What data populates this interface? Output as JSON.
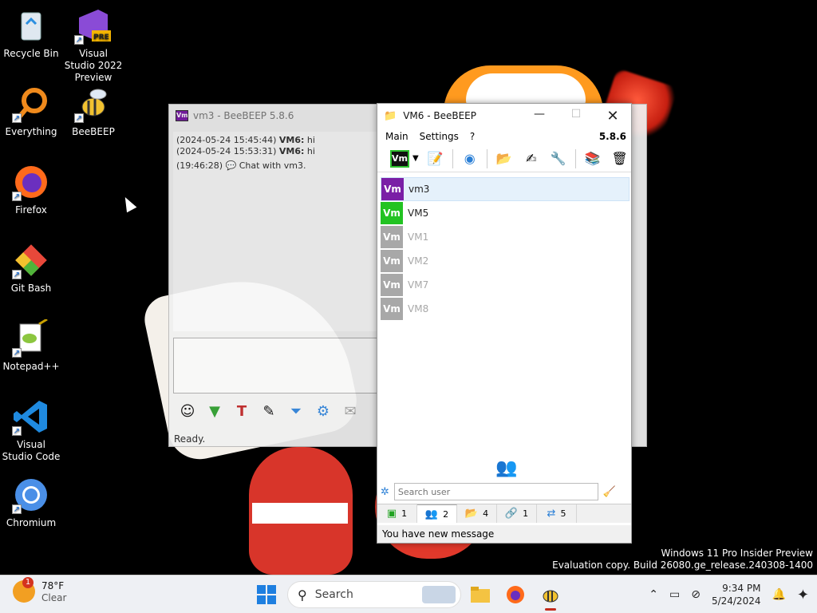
{
  "desktop": {
    "icons": [
      {
        "label": "Recycle Bin",
        "icon": "recycle-bin-icon"
      },
      {
        "label": "Visual Studio 2022 Preview",
        "icon": "visual-studio-preview-icon",
        "badge": "PRE"
      },
      {
        "label": "Everything",
        "icon": "everything-search-icon"
      },
      {
        "label": "BeeBEEP",
        "icon": "beebeep-icon"
      },
      {
        "label": "Firefox",
        "icon": "firefox-icon"
      },
      {
        "label": "Git Bash",
        "icon": "git-bash-icon"
      },
      {
        "label": "Notepad++",
        "icon": "notepad-plus-plus-icon"
      },
      {
        "label": "Visual Studio Code",
        "icon": "vscode-icon"
      },
      {
        "label": "Chromium",
        "icon": "chromium-icon"
      }
    ]
  },
  "chat_window": {
    "title": "vm3 - BeeBEEP 5.8.6",
    "badge": "Vm",
    "messages": [
      {
        "time": "(2024-05-24 15:45:44)",
        "sender": "VM6:",
        "text": " hi"
      },
      {
        "time": "(2024-05-24 15:53:31)",
        "sender": "VM6:",
        "text": " hi"
      },
      {
        "time": "(19:46:28)",
        "sender": "",
        "text": "Chat with vm3."
      }
    ],
    "status": "Ready."
  },
  "main_window": {
    "title": "VM6 - BeeBEEP",
    "version": "5.8.6",
    "menu": [
      "Main",
      "Settings",
      "?"
    ],
    "status_badge": "Vm",
    "users": [
      {
        "badge": "Vm",
        "name": "vm3",
        "state": "me",
        "selected": true
      },
      {
        "badge": "Vm",
        "name": "VM5",
        "state": "online"
      },
      {
        "badge": "Vm",
        "name": "VM1",
        "state": "off"
      },
      {
        "badge": "Vm",
        "name": "VM2",
        "state": "off"
      },
      {
        "badge": "Vm",
        "name": "VM7",
        "state": "off"
      },
      {
        "badge": "Vm",
        "name": "VM8",
        "state": "off"
      }
    ],
    "search_placeholder": "Search user",
    "tabs": [
      {
        "count": "1",
        "icon": "users-online-icon"
      },
      {
        "count": "2",
        "icon": "chats-icon"
      },
      {
        "count": "4",
        "icon": "groups-icon"
      },
      {
        "count": "1",
        "icon": "network-icon"
      },
      {
        "count": "5",
        "icon": "files-icon"
      }
    ],
    "status": "You have new message"
  },
  "watermark": {
    "line1": "Windows 11 Pro Insider Preview",
    "line2": "Evaluation copy. Build 26080.ge_release.240308-1400"
  },
  "taskbar": {
    "weather_temp": "78°F",
    "weather_desc": "Clear",
    "weather_badge": "1",
    "search_label": "Search",
    "time": "9:34 PM",
    "date": "5/24/2024"
  }
}
